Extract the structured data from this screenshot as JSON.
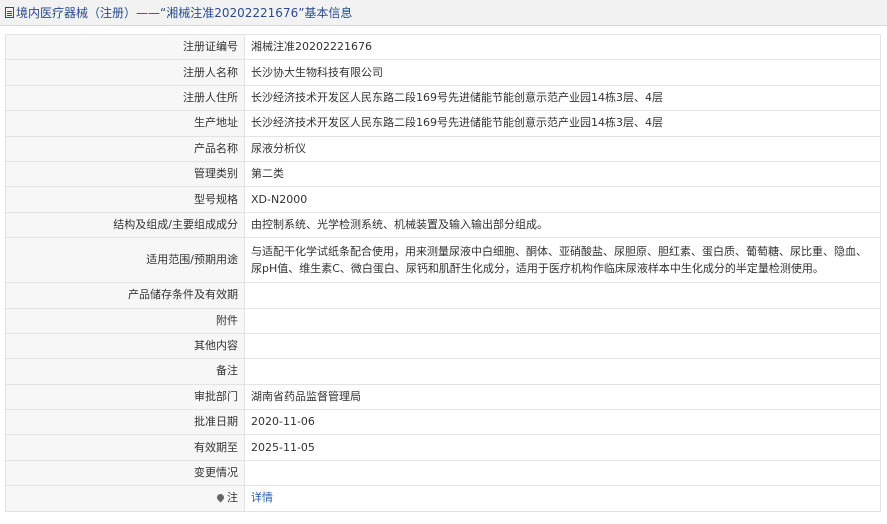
{
  "header": {
    "title": "境内医疗器械（注册）——“湘械注准20202221676”基本信息"
  },
  "rows": [
    {
      "label": "注册证编号",
      "value": "湘械注准20202221676"
    },
    {
      "label": "注册人名称",
      "value": "长沙协大生物科技有限公司"
    },
    {
      "label": "注册人住所",
      "value": "长沙经济技术开发区人民东路二段169号先进储能节能创意示范产业园14栋3层、4层"
    },
    {
      "label": "生产地址",
      "value": "长沙经济技术开发区人民东路二段169号先进储能节能创意示范产业园14栋3层、4层"
    },
    {
      "label": "产品名称",
      "value": "尿液分析仪"
    },
    {
      "label": "管理类别",
      "value": "第二类"
    },
    {
      "label": "型号规格",
      "value": "XD-N2000"
    },
    {
      "label": "结构及组成/主要组成成分",
      "value": "由控制系统、光学检测系统、机械装置及输入输出部分组成。"
    },
    {
      "label": "适用范围/预期用途",
      "value": "与适配干化学试纸条配合使用，用来测量尿液中白细胞、酮体、亚硝酸盐、尿胆原、胆红素、蛋白质、葡萄糖、尿比重、隐血、尿pH值、维生素C、微白蛋白、尿钙和肌酐生化成分，适用于医疗机构作临床尿液样本中生化成分的半定量检测使用。"
    },
    {
      "label": "产品储存条件及有效期",
      "value": ""
    },
    {
      "label": "附件",
      "value": ""
    },
    {
      "label": "其他内容",
      "value": ""
    },
    {
      "label": "备注",
      "value": ""
    },
    {
      "label": "审批部门",
      "value": "湖南省药品监督管理局"
    },
    {
      "label": "批准日期",
      "value": "2020-11-06"
    },
    {
      "label": "有效期至",
      "value": "2025-11-05"
    },
    {
      "label": "变更情况",
      "value": ""
    },
    {
      "label": "注",
      "value": "详情"
    }
  ]
}
